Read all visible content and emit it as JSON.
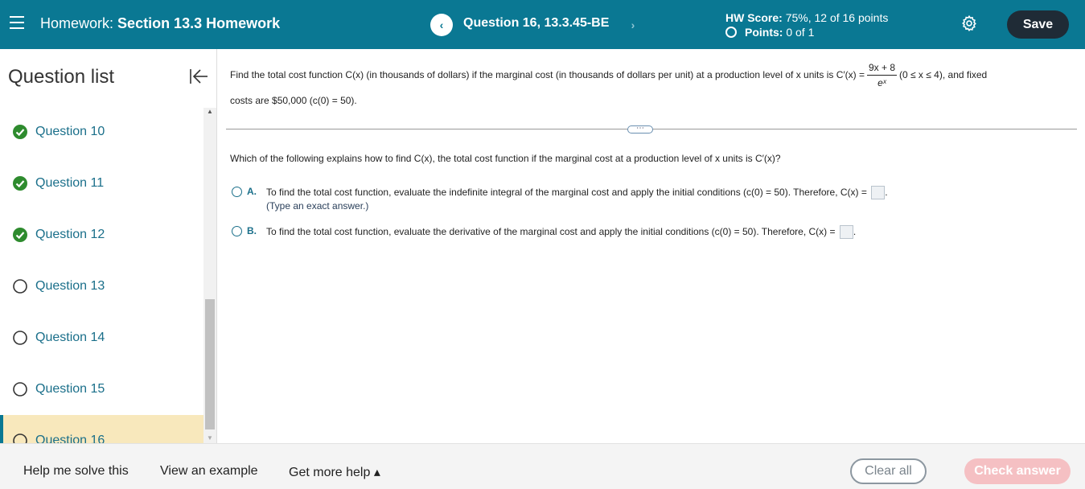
{
  "header": {
    "hw_prefix": "Homework:",
    "hw_name": "Section 13.3 Homework",
    "question_title": "Question 16, 13.3.45-BE",
    "prev_icon": "‹",
    "next_icon": "›",
    "score_label": "HW Score:",
    "score_value": "75%, 12 of 16 points",
    "points_label": "Points:",
    "points_value": "0 of 1",
    "save_label": "Save"
  },
  "sidebar": {
    "title": "Question list",
    "items": [
      {
        "label": "Question 10",
        "status": "correct"
      },
      {
        "label": "Question 11",
        "status": "correct"
      },
      {
        "label": "Question 12",
        "status": "correct"
      },
      {
        "label": "Question 13",
        "status": "unanswered"
      },
      {
        "label": "Question 14",
        "status": "unanswered"
      },
      {
        "label": "Question 15",
        "status": "unanswered"
      },
      {
        "label": "Question 16",
        "status": "current"
      }
    ]
  },
  "problem": {
    "part1": "Find the total cost function C(x) (in thousands of dollars) if the marginal cost (in thousands of dollars per unit) at a production level of x units is C′(x) =",
    "frac_num": "9x + 8",
    "frac_den": "eˣ",
    "part2": "(0 ≤ x ≤ 4), and fixed",
    "part3": "costs are $50,000 (c(0) = 50).",
    "expand_label": "⋯"
  },
  "question": {
    "prompt": "Which of the following explains how to find C(x), the total cost function if the marginal cost at a production level of x units is C′(x)?",
    "options": [
      {
        "letter": "A.",
        "text": "To find the total cost function, evaluate the indefinite integral of the marginal cost and apply the initial conditions (c(0) = 50). Therefore, C(x) =",
        "hint": "(Type an exact answer.)"
      },
      {
        "letter": "B.",
        "text": "To find the total cost function, evaluate the derivative of the marginal cost and apply the initial conditions (c(0) = 50). Therefore, C(x) ="
      }
    ]
  },
  "footer": {
    "help_solve": "Help me solve this",
    "view_example": "View an example",
    "get_help": "Get more help ▴",
    "clear_all": "Clear all",
    "check_answer": "Check answer"
  },
  "colors": {
    "header_bg": "#0a7893",
    "save_bg": "#1f2b36",
    "active_item_bg": "#f8e8bc",
    "correct_green": "#2e8b2e",
    "check_btn_bg": "#f5c0c3"
  }
}
